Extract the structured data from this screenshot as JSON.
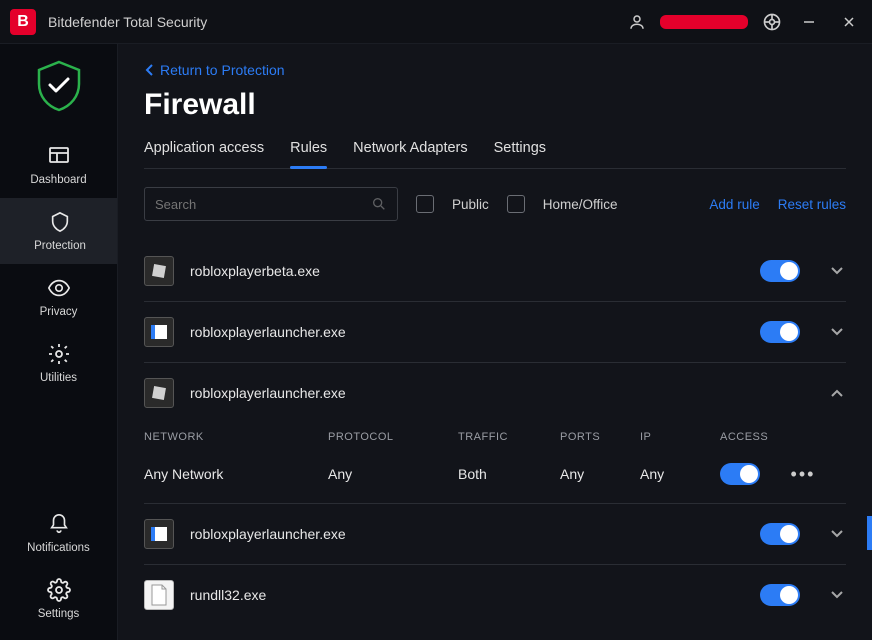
{
  "app": {
    "title": "Bitdefender Total Security"
  },
  "sidebar": {
    "items": [
      {
        "label": "Dashboard"
      },
      {
        "label": "Protection"
      },
      {
        "label": "Privacy"
      },
      {
        "label": "Utilities"
      },
      {
        "label": "Notifications"
      },
      {
        "label": "Settings"
      }
    ]
  },
  "main": {
    "breadcrumb": "Return to Protection",
    "title": "Firewall",
    "tabs": [
      {
        "label": "Application access"
      },
      {
        "label": "Rules"
      },
      {
        "label": "Network Adapters"
      },
      {
        "label": "Settings"
      }
    ],
    "search_placeholder": "Search",
    "filters": {
      "public": "Public",
      "home": "Home/Office"
    },
    "links": {
      "add": "Add rule",
      "reset": "Reset rules"
    },
    "columns": {
      "network": "NETWORK",
      "protocol": "PROTOCOL",
      "traffic": "TRAFFIC",
      "ports": "PORTS",
      "ip": "IP",
      "access": "ACCESS"
    },
    "rules": [
      {
        "name": "robloxplayerbeta.exe",
        "icon": "roblox",
        "enabled": true,
        "expanded": false
      },
      {
        "name": "robloxplayerlauncher.exe",
        "icon": "win",
        "enabled": true,
        "expanded": false
      },
      {
        "name": "robloxplayerlauncher.exe",
        "icon": "roblox",
        "enabled": true,
        "expanded": true,
        "detail": {
          "network": "Any Network",
          "protocol": "Any",
          "traffic": "Both",
          "ports": "Any",
          "ip": "Any",
          "enabled": true
        }
      },
      {
        "name": "robloxplayerlauncher.exe",
        "icon": "win",
        "enabled": true,
        "expanded": false
      },
      {
        "name": "rundll32.exe",
        "icon": "file",
        "enabled": true,
        "expanded": false
      }
    ]
  }
}
